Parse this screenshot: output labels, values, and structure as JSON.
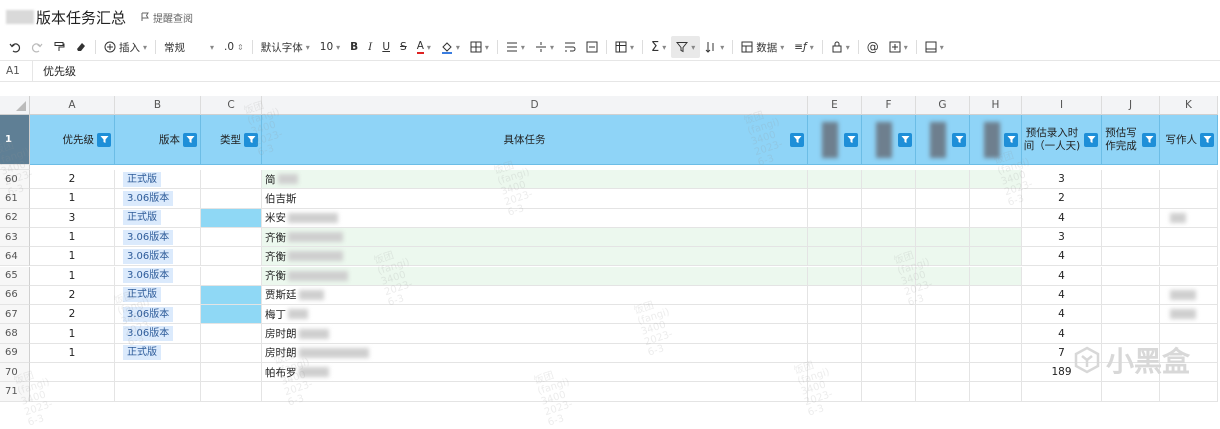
{
  "title": "版本任务汇总",
  "remind_label": "提醒查阅",
  "toolbar": {
    "insert": "插入",
    "format": "常规",
    "decimal": ".0",
    "font": "默认字体",
    "size": "10",
    "bold": "B",
    "italic": "I",
    "underline": "U",
    "strike": "S",
    "font_color": "A",
    "data": "数据"
  },
  "formula_bar": {
    "cell_ref": "A1",
    "value": "优先级"
  },
  "columns": [
    "A",
    "B",
    "C",
    "D",
    "E",
    "F",
    "G",
    "H",
    "I",
    "J",
    "K"
  ],
  "header": {
    "priority": "优先级",
    "version": "版本",
    "type": "类型",
    "task": "具体任务",
    "estimate": "预估录入时间（一人天)",
    "estimate_write": "预估写作完成",
    "writer": "写作人"
  },
  "rows": [
    {
      "num": "60",
      "priority": "2",
      "version": "正式版",
      "task": "简",
      "est": "3",
      "green": true,
      "blue": false,
      "blur": 20
    },
    {
      "num": "61",
      "priority": "1",
      "version": "3.06版本",
      "task": "伯吉斯",
      "est": "2",
      "green": false,
      "blue": false,
      "blur": 0
    },
    {
      "num": "62",
      "priority": "3",
      "version": "正式版",
      "task": "米安",
      "est": "4",
      "green": false,
      "blue": true,
      "blur": 50
    },
    {
      "num": "63",
      "priority": "1",
      "version": "3.06版本",
      "task": "齐衡",
      "est": "3",
      "green": true,
      "blue": false,
      "blur": 55
    },
    {
      "num": "64",
      "priority": "1",
      "version": "3.06版本",
      "task": "齐衡",
      "est": "4",
      "green": true,
      "blue": false,
      "blur": 55
    },
    {
      "num": "65",
      "priority": "1",
      "version": "3.06版本",
      "task": "齐衡",
      "est": "4",
      "green": true,
      "blue": false,
      "blur": 60
    },
    {
      "num": "66",
      "priority": "2",
      "version": "正式版",
      "task": "贾斯廷",
      "est": "4",
      "green": false,
      "blue": true,
      "blur": 25
    },
    {
      "num": "67",
      "priority": "2",
      "version": "3.06版本",
      "task": "梅丁",
      "est": "4",
      "green": false,
      "blue": true,
      "blur": 20
    },
    {
      "num": "68",
      "priority": "1",
      "version": "3.06版本",
      "task": "房时朗",
      "est": "4",
      "green": false,
      "blue": false,
      "blur": 30
    },
    {
      "num": "69",
      "priority": "1",
      "version": "正式版",
      "task": "房时朗",
      "est": "7",
      "green": false,
      "blue": false,
      "blur": 70
    },
    {
      "num": "70",
      "priority": "",
      "version": "",
      "task": "帕布罗",
      "est": "189",
      "green": false,
      "blue": false,
      "blur": 30
    },
    {
      "num": "71",
      "priority": "",
      "version": "",
      "task": "",
      "est": "",
      "green": false,
      "blue": false,
      "blur": 0
    }
  ],
  "watermark": "饭团(fangi) 3400 2023-6-3",
  "logo_text": "小黑盒"
}
